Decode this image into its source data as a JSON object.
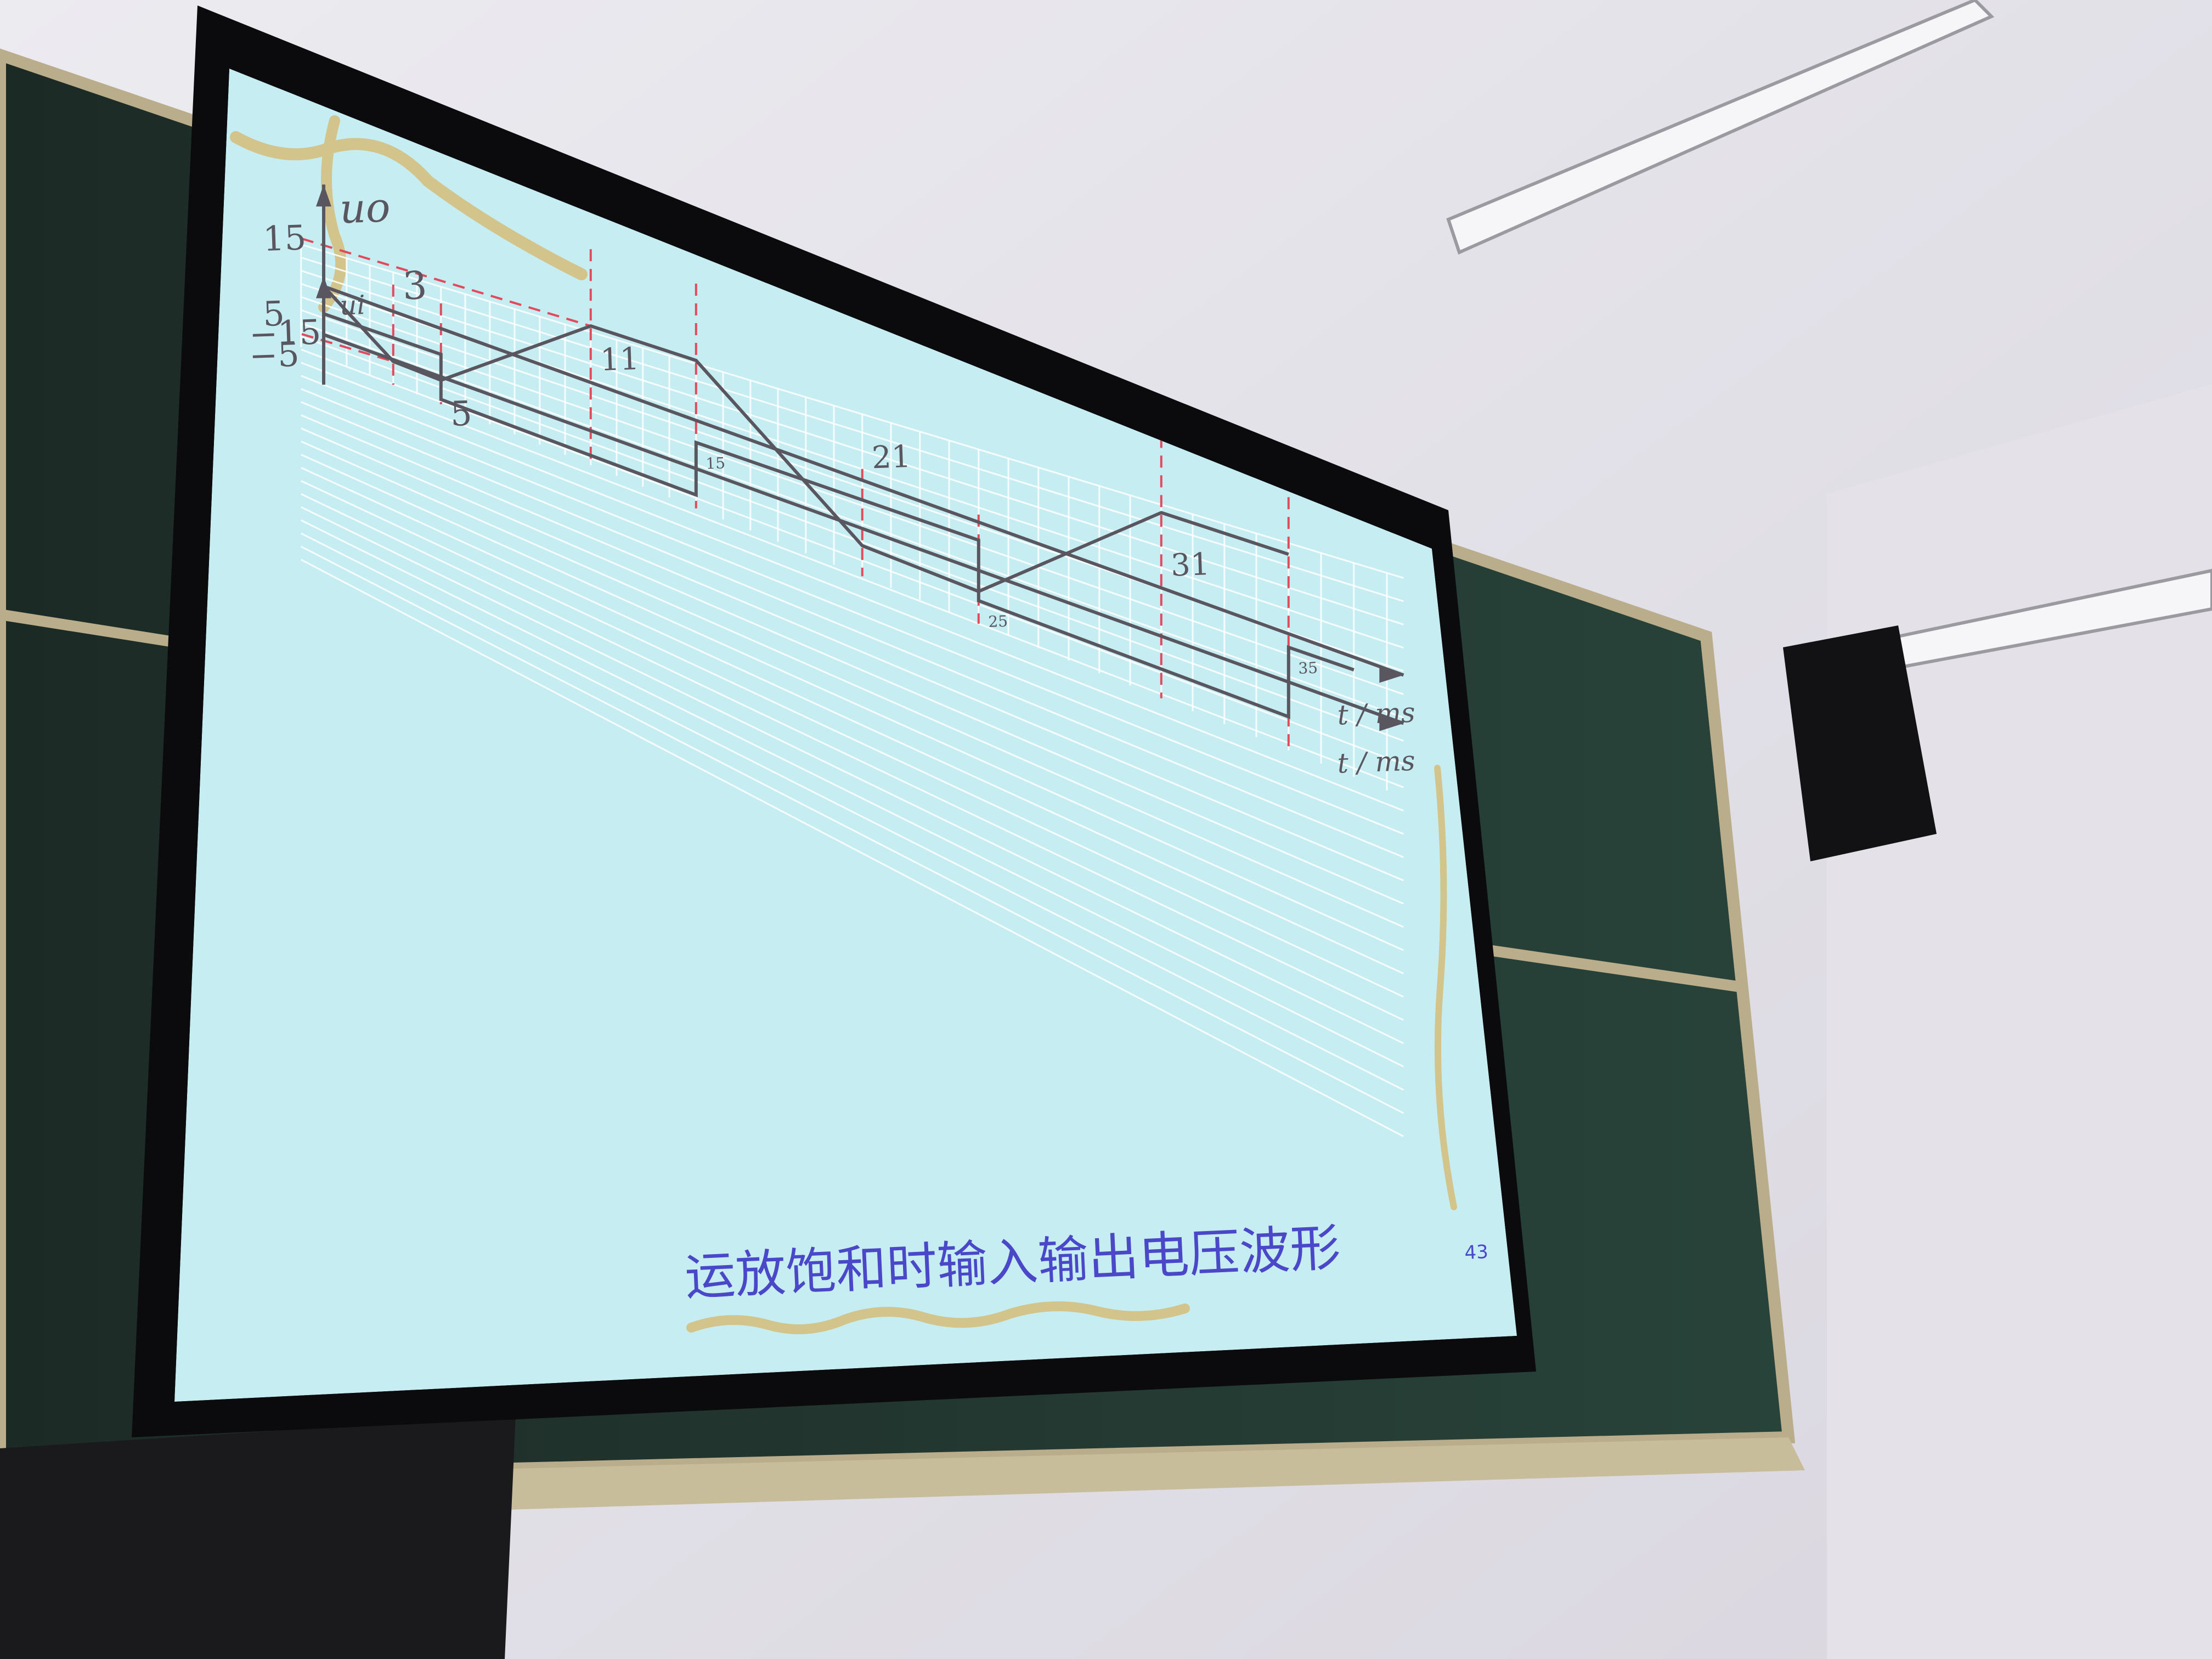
{
  "colors": {
    "slide_bg": "#c6eef2",
    "grid": "#ffffff",
    "line": "#5a5660",
    "guide": "#e24a5c",
    "title": "#4a47c8",
    "accent": "#d2c48a"
  },
  "slide": {
    "title": "运放饱和时输入输出电压波形",
    "page_number": "43"
  },
  "chart_data": [
    {
      "type": "line",
      "title": "",
      "ylabel": "ui",
      "xlabel": "t / ms",
      "y_ticks": [
        "5",
        "−5"
      ],
      "x_range": [
        0,
        38
      ],
      "y_range": [
        -5,
        5
      ],
      "series": [
        {
          "x": [
            0,
            5,
            5,
            15,
            15,
            25,
            25,
            35,
            35,
            37
          ],
          "y": [
            5,
            5,
            -5,
            -5,
            5,
            5,
            -5,
            -5,
            5,
            5
          ]
        }
      ],
      "annotations": [
        "5",
        "15",
        "25",
        "35"
      ]
    },
    {
      "type": "line",
      "title": "",
      "ylabel": "uo",
      "xlabel": "t / ms",
      "y_ticks": [
        "15",
        "−15"
      ],
      "x_range": [
        0,
        38
      ],
      "y_range": [
        -15,
        15
      ],
      "series": [
        {
          "x": [
            0,
            3,
            5,
            11,
            15,
            21,
            25,
            31,
            35
          ],
          "y": [
            0,
            -15,
            -15,
            15,
            15,
            -15,
            -15,
            15,
            15
          ]
        }
      ],
      "annotations": [
        "3",
        "11",
        "21",
        "31"
      ]
    }
  ]
}
